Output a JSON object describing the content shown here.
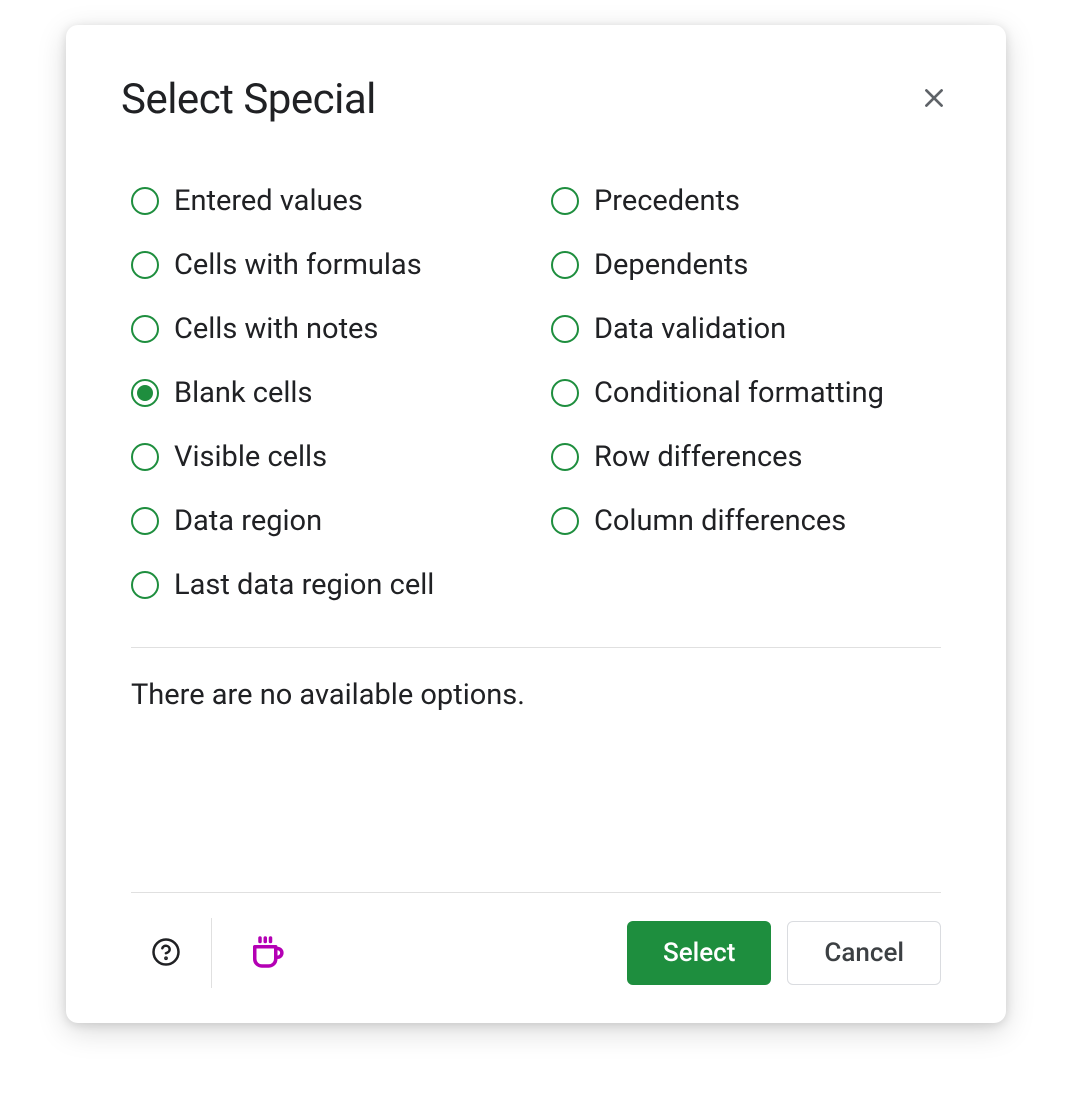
{
  "dialog": {
    "title": "Select Special",
    "options_left": [
      {
        "label": "Entered values",
        "selected": false
      },
      {
        "label": "Cells with formulas",
        "selected": false
      },
      {
        "label": "Cells with notes",
        "selected": false
      },
      {
        "label": "Blank cells",
        "selected": true
      },
      {
        "label": "Visible cells",
        "selected": false
      },
      {
        "label": "Data region",
        "selected": false
      },
      {
        "label": "Last data region cell",
        "selected": false
      }
    ],
    "options_right": [
      {
        "label": "Precedents",
        "selected": false
      },
      {
        "label": "Dependents",
        "selected": false
      },
      {
        "label": "Data validation",
        "selected": false
      },
      {
        "label": "Conditional formatting",
        "selected": false
      },
      {
        "label": "Row differences",
        "selected": false
      },
      {
        "label": "Column differences",
        "selected": false
      }
    ],
    "message": "There are no available options.",
    "buttons": {
      "primary": "Select",
      "secondary": "Cancel"
    }
  }
}
